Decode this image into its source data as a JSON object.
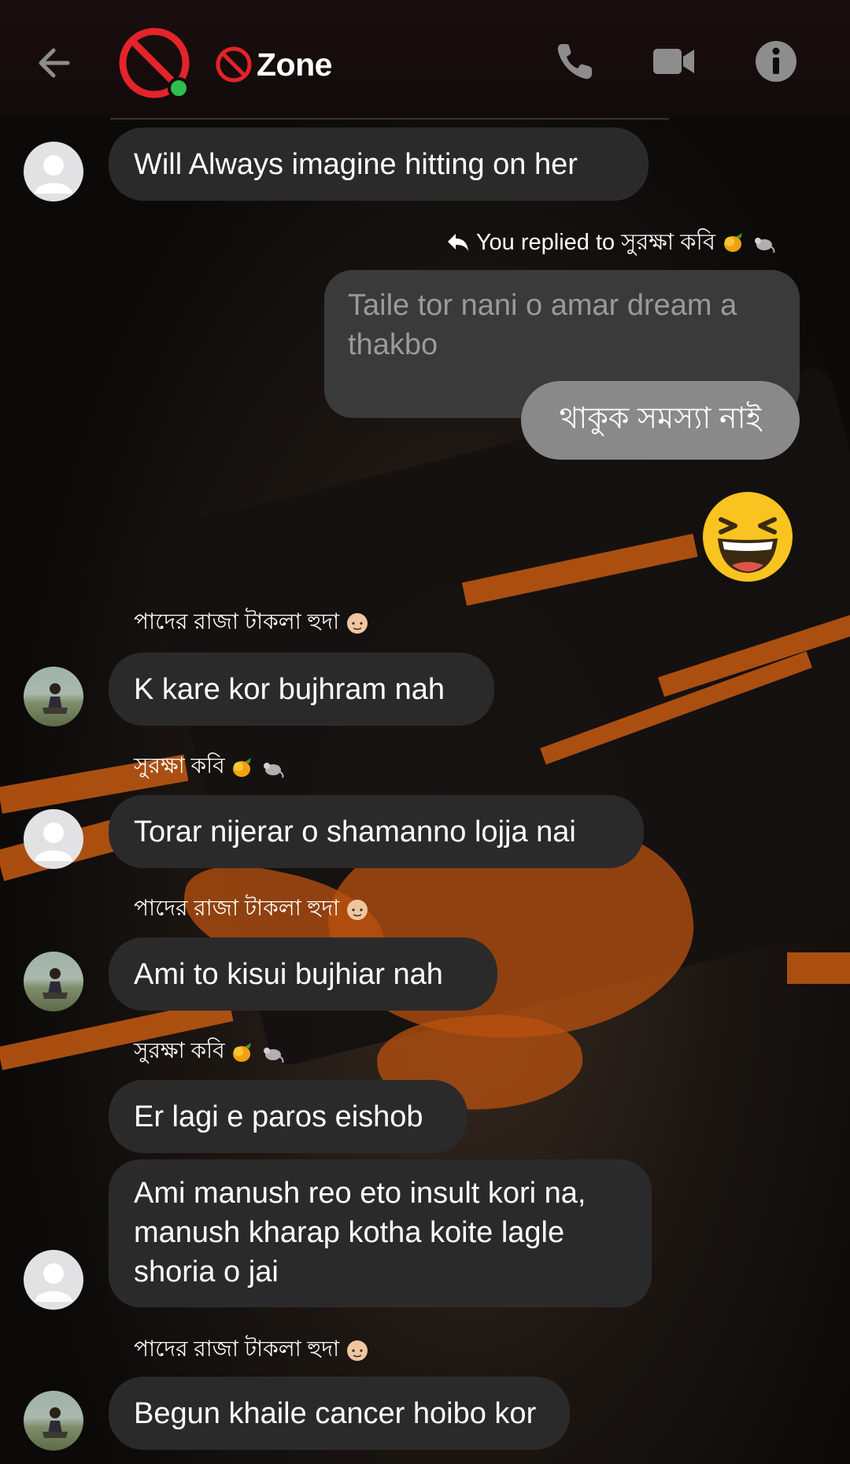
{
  "header": {
    "title": "Zone",
    "back_icon": "arrow-left-icon",
    "call_icon": "phone-icon",
    "video_icon": "video-camera-icon",
    "info_icon": "info-icon",
    "online": true
  },
  "colors": {
    "accent_red": "#e4232a",
    "online_green": "#2ebd4e",
    "bubble": "#2b2a2b",
    "my_bubble": "#8a898a"
  },
  "messages": [
    {
      "text": "Will Always imagine hitting on her"
    },
    {
      "reply_note": "You replied to সুরক্ষা কবি",
      "quoted": "Taile tor nani o amar dream a thakbo",
      "text": "থাকুক সমস্যা নাই"
    },
    {
      "emoji": "grinning-squinting-face"
    },
    {
      "sender": "পাদের রাজা টাকলা হুদা",
      "text": "K kare kor bujhram nah"
    },
    {
      "sender": "সুরক্ষা কবি",
      "text": "Torar nijerar o shamanno lojja nai"
    },
    {
      "sender": "পাদের রাজা টাকলা হুদা",
      "text": "Ami to kisui bujhiar nah"
    },
    {
      "sender": "সুরক্ষা কবি",
      "text": "Er lagi e paros eishob"
    },
    {
      "text": "Ami manush reo eto insult kori na, manush kharap kotha koite lagle shoria o jai"
    },
    {
      "sender": "পাদের রাজা টাকলা হুদা",
      "text": "Begun khaile cancer hoibo kor"
    }
  ]
}
